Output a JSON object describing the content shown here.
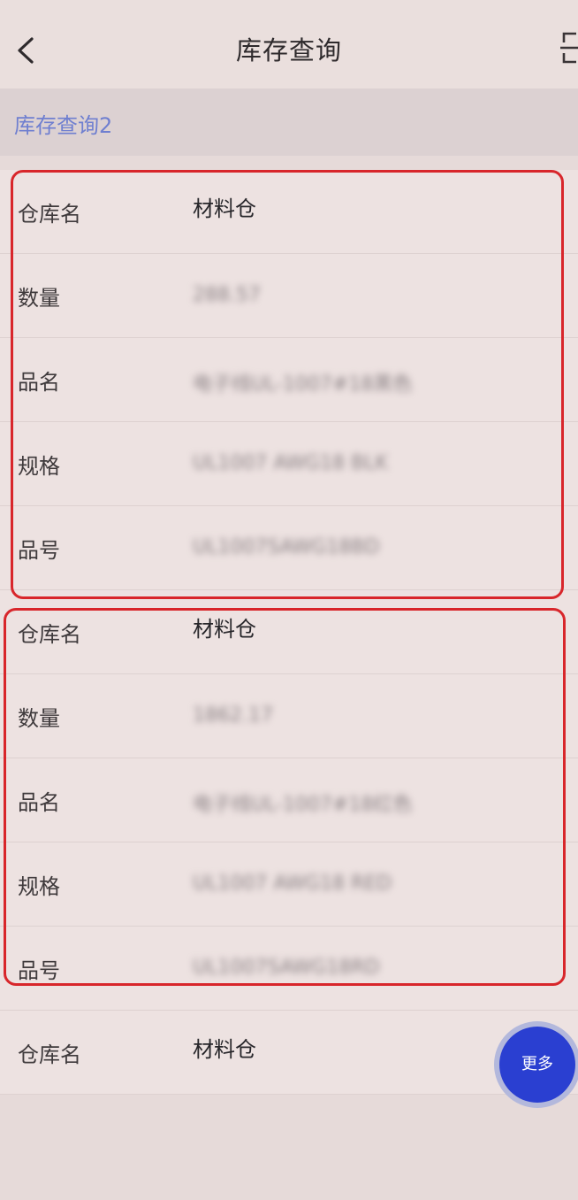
{
  "navbar": {
    "title": "库存查询",
    "back_icon": "chevron-left-icon",
    "scan_icon": "scan-icon"
  },
  "section": {
    "title": "库存查询2"
  },
  "records": [
    {
      "rows": [
        {
          "label": "仓库名",
          "value": "材料仓",
          "blurred": false
        },
        {
          "label": "数量",
          "value": "288.57",
          "blurred": true
        },
        {
          "label": "品名",
          "value": "电子线UL-1007#18黑色",
          "blurred": true
        },
        {
          "label": "规格",
          "value": "UL1007 AWG18 BLK",
          "blurred": true
        },
        {
          "label": "品号",
          "value": "UL1007SAWG18BD",
          "blurred": true
        }
      ]
    },
    {
      "rows": [
        {
          "label": "仓库名",
          "value": "材料仓",
          "blurred": false
        },
        {
          "label": "数量",
          "value": "1862.17",
          "blurred": true
        },
        {
          "label": "品名",
          "value": "电子线UL-1007#18红色",
          "blurred": true
        },
        {
          "label": "规格",
          "value": "UL1007 AWG18 RED",
          "blurred": true
        },
        {
          "label": "品号",
          "value": "UL1007SAWG18RD",
          "blurred": true
        }
      ]
    },
    {
      "rows": [
        {
          "label": "仓库名",
          "value": "材料仓",
          "blurred": false
        }
      ]
    }
  ],
  "more_button": {
    "label": "更多"
  },
  "colors": {
    "accent": "#2a3fd1",
    "highlight_frame": "#d8262b",
    "section_title": "#6f7fd0"
  }
}
